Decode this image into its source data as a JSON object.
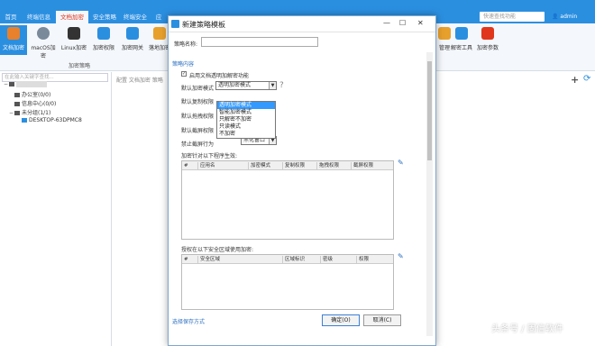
{
  "nav": {
    "tabs": [
      "首页",
      "终端信息",
      "文档加密",
      "安全策略",
      "终端安全",
      "应"
    ],
    "active_tab": 2,
    "search_placeholder": "快速查找功能",
    "user_label": "admin"
  },
  "ribbon": {
    "buttons": [
      {
        "label": "文档加密",
        "icon": "encrypt-doc-icon",
        "color": "#e8802c",
        "active": true
      },
      {
        "label": "macOS加密",
        "icon": "apple-icon",
        "color": "#7a8a9a"
      },
      {
        "label": "Linux加密",
        "icon": "linux-icon",
        "color": "#333333"
      },
      {
        "label": "加密权限",
        "icon": "lock-icon",
        "color": "#2b8fe0"
      },
      {
        "label": "加密网关",
        "icon": "gateway-icon",
        "color": "#2b8fe0"
      },
      {
        "label": "落地加密",
        "icon": "landing-encrypt-icon",
        "color": "#e8a02c"
      }
    ],
    "right_buttons": [
      {
        "label": "管理",
        "icon": "manage-icon",
        "color": "#e8a02c"
      },
      {
        "label": "解密工具",
        "icon": "decrypt-tool-icon",
        "color": "#2b8fe0"
      },
      {
        "label": "加密参数",
        "icon": "encrypt-params-icon",
        "color": "#e0361b"
      }
    ],
    "group_label": "加密策略"
  },
  "tree": {
    "filter_placeholder": "在此输入关键字查找...",
    "items": [
      {
        "label": "■■■■■■",
        "level": 0,
        "toggle": "−"
      },
      {
        "label": "办公室(0/0)",
        "level": 1,
        "toggle": ""
      },
      {
        "label": "信息中心(0/0)",
        "level": 1,
        "toggle": ""
      },
      {
        "label": "未分组(1/1)",
        "level": 1,
        "toggle": "−"
      },
      {
        "label": "DESKTOP-63DPMC8",
        "level": 2,
        "toggle": ""
      }
    ]
  },
  "main": {
    "breadcrumb": "配置 文档加密 策略"
  },
  "dialog": {
    "title": "新建策略模板",
    "name_label": "策略名称:",
    "name_value": "",
    "section_label": "策略内容",
    "enable_label": "启用文档透明加解密功能",
    "enable_checked": true,
    "mode_label": "默认加密模式",
    "mode_value": "透明加密模式",
    "help_symbol": "?",
    "copy_label": "默认复制权限",
    "drag_label": "默认拖拽权限",
    "screenshot_label": "默认截屏权限",
    "forbid_label": "禁止截屏行为",
    "forbid_value": "黑化窗口",
    "dropdown_options": [
      "透明加密模式",
      "智能加密模式",
      "只解密不加密",
      "只读模式",
      "不加密"
    ],
    "dropdown_selected": 0,
    "grid1_caption": "加密针对以下程序生效:",
    "grid1_headers": [
      "#",
      "应用名",
      "加密模式",
      "复制权限",
      "拖拽权限",
      "截屏权限"
    ],
    "grid2_caption": "授权在以下安全区域使用加密:",
    "grid2_headers": [
      "#",
      "安全区域",
      "区域标识",
      "密级",
      "权限"
    ],
    "footer_link": "选择保存方式",
    "ok_label": "确定(O)",
    "cancel_label": "取消(C)"
  },
  "watermark": "头条号 / 固信软件"
}
